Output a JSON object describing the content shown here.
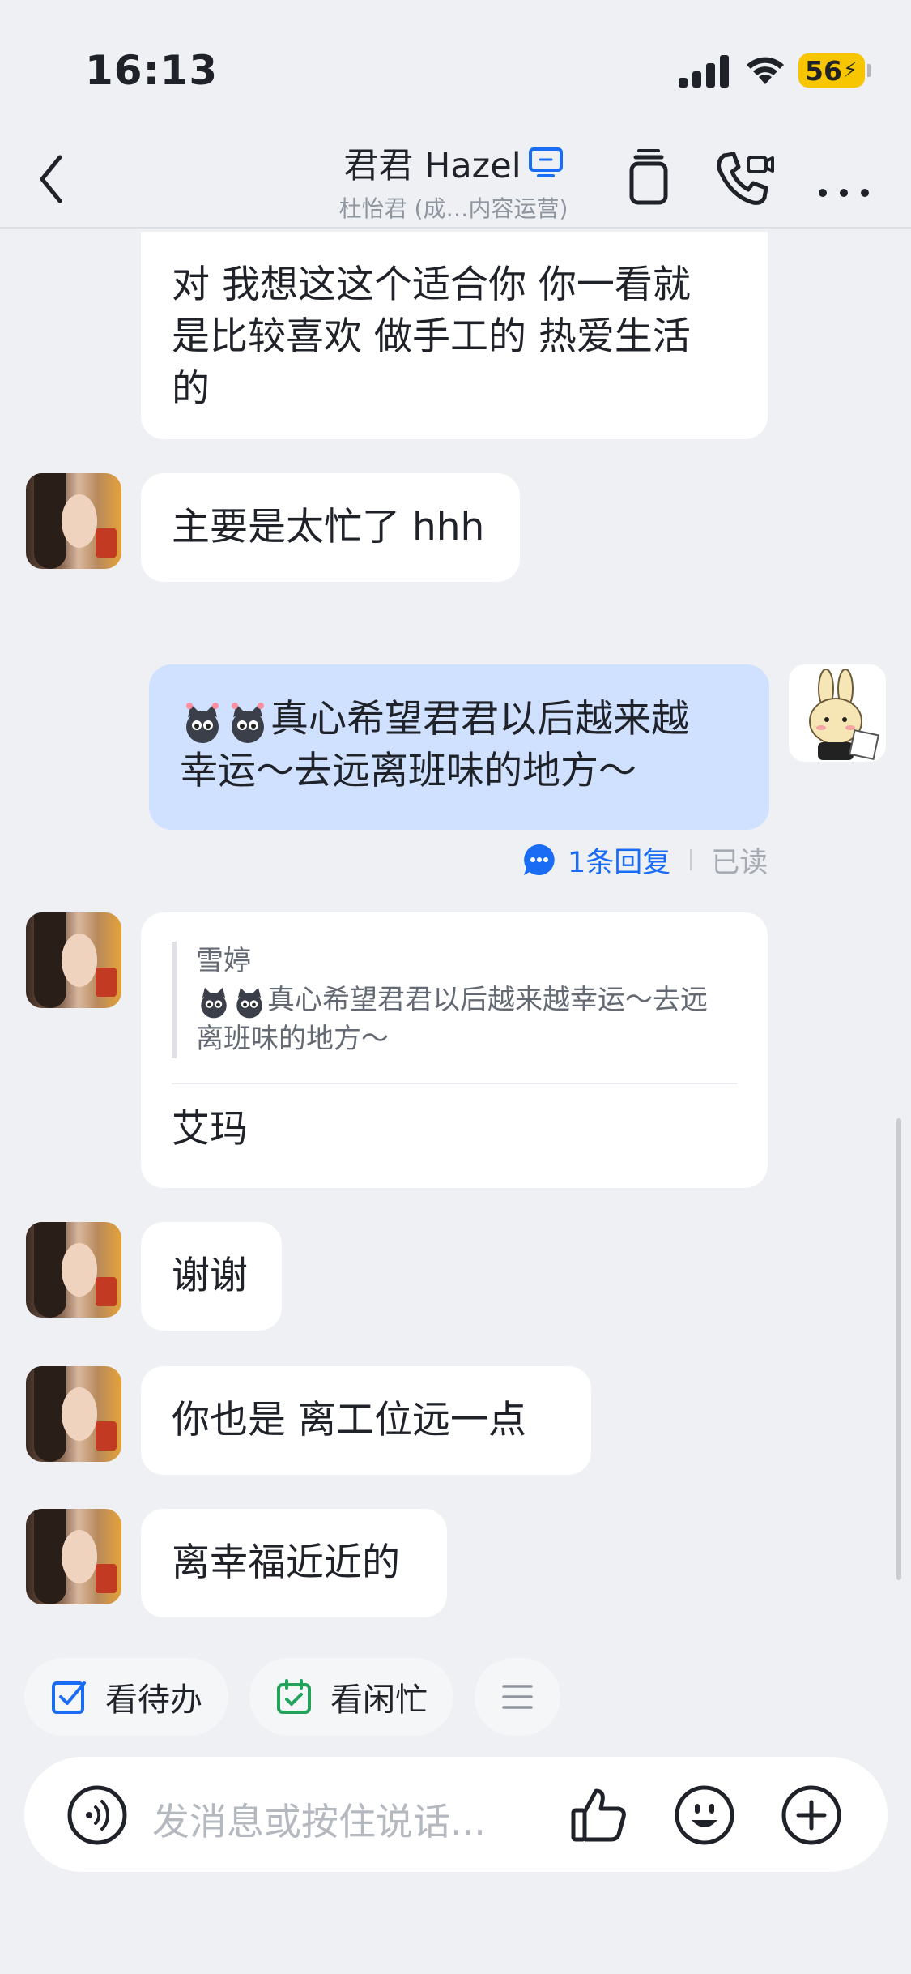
{
  "status_bar": {
    "time": "16:13",
    "battery": "56"
  },
  "header": {
    "title": "君君 Hazel",
    "subtitle": "杜怡君 (成…内容运营)",
    "icons": [
      "back-icon",
      "device-icon",
      "docs-icon",
      "call-icon",
      "more-icon"
    ]
  },
  "messages": [
    {
      "from": "other",
      "text_lines": [
        "对 我想这这个适合你 你一看就",
        "是比较喜欢 做手工的 热爱生活",
        "的"
      ]
    },
    {
      "from": "other",
      "text": "主要是太忙了 hhh"
    },
    {
      "from": "me",
      "text_line1": "真心希望君君以后越来越",
      "text_line2": "幸运～去远离班味的地方～",
      "reply_count": "1条回复",
      "status": "已读"
    },
    {
      "from": "other",
      "quote_author": "雪婷",
      "quote_line1": "真心希望君君以后越来越幸运～去远",
      "quote_line2": "离班味的地方～",
      "text": "艾玛"
    },
    {
      "from": "other",
      "text": "谢谢"
    },
    {
      "from": "other",
      "text": "你也是 离工位远一点"
    },
    {
      "from": "other",
      "text": "离幸福近近的"
    }
  ],
  "quick_actions": [
    {
      "label": "看待办",
      "icon": "checkbox-icon"
    },
    {
      "label": "看闲忙",
      "icon": "calendar-check-icon"
    },
    {
      "label": "",
      "icon": "menu-icon"
    }
  ],
  "composer": {
    "placeholder": "发消息或按住说话...",
    "icons": [
      "voice-icon",
      "thumbs-up-icon",
      "emoji-icon",
      "plus-icon"
    ]
  },
  "colors": {
    "accent": "#1a6cf5",
    "sent_bubble": "#cfe1ff",
    "background": "#eef0f4",
    "battery": "#f7c600"
  }
}
